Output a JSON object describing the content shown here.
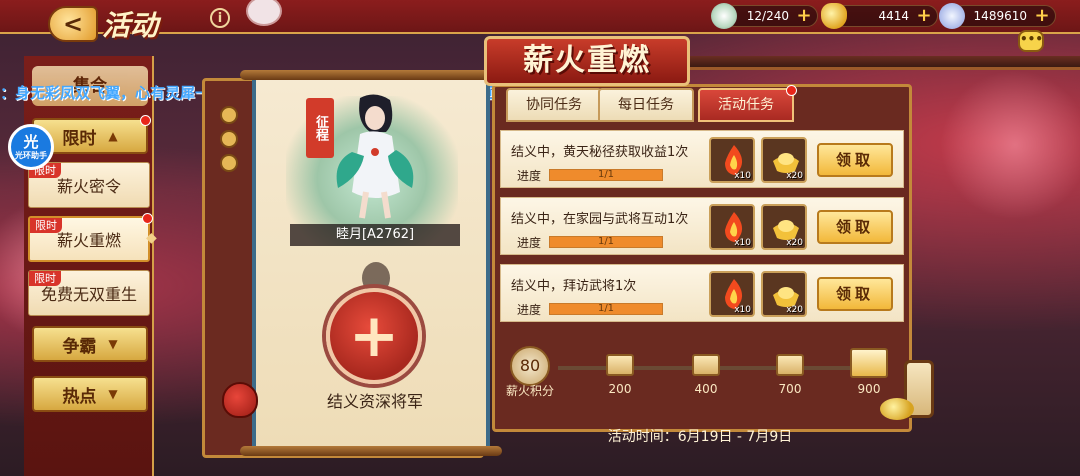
{
  "header": {
    "title": "活动",
    "back_label": "<",
    "info_label": "i",
    "chat_label": "•••"
  },
  "resources": [
    {
      "name": "stamina",
      "value": "12/240"
    },
    {
      "name": "gold",
      "value": "4414"
    },
    {
      "name": "jade",
      "value": "1489610"
    }
  ],
  "marquee": "：身无彩凤双飞翼，心有灵犀一点通！玩家陈留秦湘琳解锁翎沄诸葛果插画，真爱满满！",
  "overlay_logo": {
    "main": "光",
    "sub": "光环助手"
  },
  "sidebar": {
    "top_label": "集合",
    "groups": [
      {
        "label": "限时",
        "arrow": "▲"
      },
      {
        "label": "争霸",
        "arrow": "▼"
      },
      {
        "label": "热点",
        "arrow": "▼"
      }
    ],
    "items": [
      {
        "badge": "限时",
        "label": "薪火密令"
      },
      {
        "badge": "限时",
        "label": "薪火重燃"
      },
      {
        "badge": "限时",
        "label": "免费无双重生"
      }
    ]
  },
  "hero": {
    "tag": "征程",
    "name": "睦月[A2762]",
    "slot_label": "结义资深将军"
  },
  "event": {
    "title": "薪火重燃",
    "tabs": [
      "协同任务",
      "每日任务",
      "活动任务"
    ],
    "active_tab": 2,
    "tasks": [
      {
        "text": "结义中，黄天秘径获取收益1次",
        "progress_label": "进度",
        "progress": "1/1",
        "fill": 1.0,
        "rewards": [
          "x10",
          "x20"
        ],
        "claim": "领取"
      },
      {
        "text": "结义中，在家园与武将互动1次",
        "progress_label": "进度",
        "progress": "1/1",
        "fill": 1.0,
        "rewards": [
          "x10",
          "x20"
        ],
        "claim": "领取"
      },
      {
        "text": "结义中，拜访武将1次",
        "progress_label": "进度",
        "progress": "1/1",
        "fill": 1.0,
        "rewards": [
          "x10",
          "x20"
        ],
        "claim": "领取"
      }
    ],
    "points": {
      "value": "80",
      "label": "薪火积分"
    },
    "milestones": [
      "200",
      "400",
      "700",
      "900"
    ],
    "time_text": "活动时间：6月19日 - 7月9日"
  },
  "colors": {
    "accent_red": "#d23b2a",
    "gold": "#f2b83a",
    "paper": "#f6ead2",
    "marquee": "#44a8ff"
  }
}
